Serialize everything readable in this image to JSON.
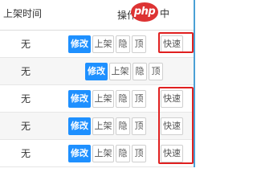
{
  "header": {
    "shelf_time": "上架时间",
    "ops": "操作",
    "logo_text": "php",
    "edge_text": "中文"
  },
  "rows": [
    {
      "shelf_time": "无",
      "edit": "修改",
      "shelf": "上架",
      "hide": "隐",
      "top": "顶",
      "express": "快速"
    },
    {
      "shelf_time": "无",
      "edit": "修改",
      "shelf": "上架",
      "hide": "隐",
      "top": "顶"
    },
    {
      "shelf_time": "无",
      "edit": "修改",
      "shelf": "上架",
      "hide": "隐",
      "top": "顶",
      "express": "快速"
    },
    {
      "shelf_time": "无",
      "edit": "修改",
      "shelf": "上架",
      "hide": "隐",
      "top": "顶",
      "express": "快速"
    },
    {
      "shelf_time": "无",
      "edit": "修改",
      "shelf": "上架",
      "hide": "隐",
      "top": "顶",
      "express": "快速"
    }
  ],
  "colors": {
    "primary": "#1e90ff",
    "highlight": "#e02020",
    "logo": "#dd3333"
  }
}
